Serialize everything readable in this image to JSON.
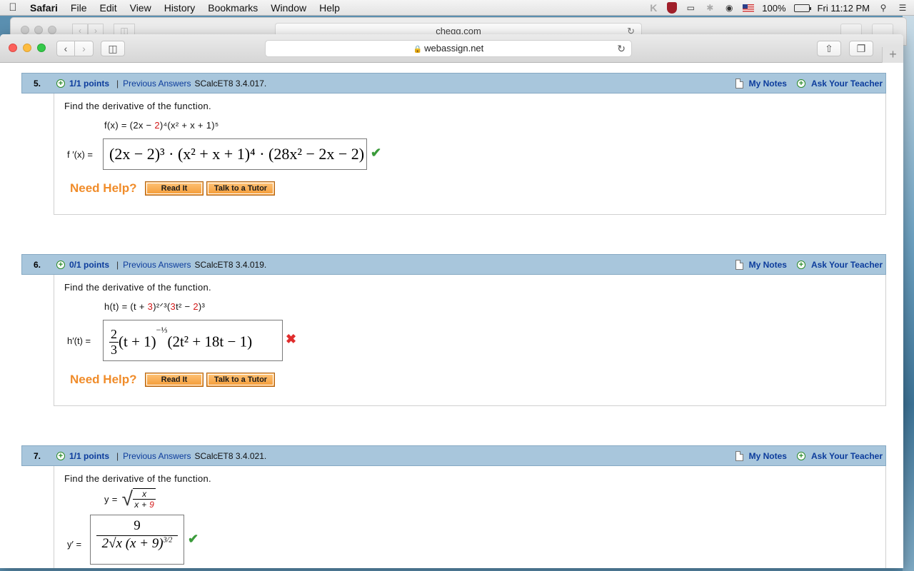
{
  "menubar": {
    "app": "Safari",
    "items": [
      "File",
      "Edit",
      "View",
      "History",
      "Bookmarks",
      "Window",
      "Help"
    ],
    "battery": "100%",
    "clock": "Fri 11:12 PM"
  },
  "back_window": {
    "url": "chegg.com"
  },
  "window": {
    "url": "webassign.net"
  },
  "common": {
    "my_notes": "My Notes",
    "ask_teacher": "Ask Your Teacher",
    "previous_answers": "Previous Answers",
    "prompt": "Find the derivative of the function.",
    "need_help": "Need Help?",
    "read_it": "Read It",
    "talk_tutor": "Talk to a Tutor"
  },
  "questions": [
    {
      "number": "5.",
      "points": "1/1 points",
      "code": "SCalcET8 3.4.017.",
      "func_lhs": "f(x) = (2x − ",
      "func_red1": "2",
      "func_rest": ")⁴(x² + x + 1)⁵",
      "answer_label": "f ′(x) =",
      "answer": "(2x − 2)³ · (x² + x + 1)⁴ · (28x² − 2x − 2)",
      "status": "correct"
    },
    {
      "number": "6.",
      "points": "0/1 points",
      "code": "SCalcET8 3.4.019.",
      "func_lhs": "h(t) = (t + ",
      "func_red1": "3",
      "func_mid": ")²ᐟ³(",
      "func_red2": "3",
      "func_mid2": "t² − ",
      "func_red3": "2",
      "func_end": ")³",
      "answer_label": "h′(t) =",
      "answer_num": "2",
      "answer_den": "3",
      "answer_rest": "(t + 1)",
      "answer_exp": "−⅓",
      "answer_tail": "(2t² + 18t − 1)",
      "status": "incorrect"
    },
    {
      "number": "7.",
      "points": "1/1 points",
      "code": "SCalcET8 3.4.021.",
      "func_lhs": "y =",
      "func_num": "x",
      "func_den_a": "x + ",
      "func_den_red": "9",
      "answer_label": "y′ =",
      "answer_num": "9",
      "answer_den": "2√x (x + 9)",
      "answer_den_exp": "3/2",
      "status": "correct"
    }
  ]
}
